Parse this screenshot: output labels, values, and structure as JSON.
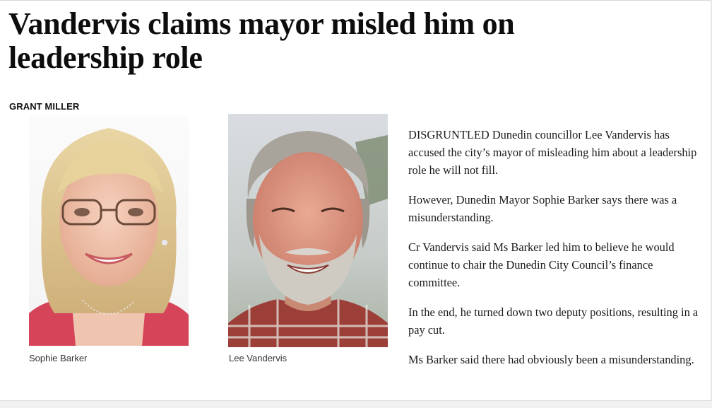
{
  "article": {
    "headline": "Vandervis claims mayor misled him on leadership role",
    "byline": "GRANT MILLER",
    "paragraphs": [
      "DISGRUNTLED Dunedin councillor Lee Vandervis has accused the city’s mayor of misleading him about a leadership role he will not fill.",
      "However, Dunedin Mayor Sophie Barker says there was a misunderstanding.",
      "Cr Vandervis said Ms Barker led him to believe he would continue to chair the Dunedin City Council’s finance committee.",
      "In the end, he turned down two deputy positions, resulting in a pay cut.",
      "Ms Barker said there had obviously been a misunderstanding."
    ]
  },
  "photos": [
    {
      "caption": "Sophie Barker",
      "icon": "woman-portrait-photo"
    },
    {
      "caption": "Lee Vandervis",
      "icon": "man-portrait-photo"
    }
  ],
  "colors": {
    "headline": "#0d0d0d",
    "body_text": "#1a1a1a",
    "caption": "#333333",
    "background": "#ffffff"
  }
}
